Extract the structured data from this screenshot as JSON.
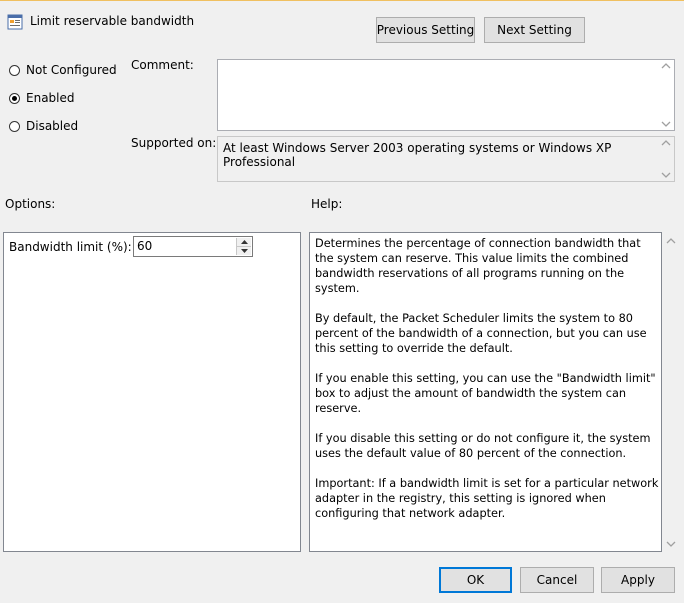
{
  "window": {
    "title": "Limit reservable bandwidth",
    "icon": "policy-setting-icon"
  },
  "nav": {
    "previous_label": "Previous Setting",
    "next_label": "Next Setting"
  },
  "state": {
    "options": [
      "Not Configured",
      "Enabled",
      "Disabled"
    ],
    "selected": "Enabled"
  },
  "comment": {
    "label": "Comment:",
    "value": ""
  },
  "supported": {
    "label": "Supported on:",
    "value": "At least Windows Server 2003 operating systems or Windows XP Professional"
  },
  "options_section": {
    "header": "Options:",
    "bandwidth_label": "Bandwidth limit (%):",
    "bandwidth_value": "60"
  },
  "help": {
    "header": "Help:",
    "paragraphs": [
      "Determines the percentage of connection bandwidth that the system can reserve. This value limits the combined bandwidth reservations of all programs running on the system.",
      "By default, the Packet Scheduler limits the system to 80 percent of the bandwidth of a connection, but you can use this setting to override the default.",
      "If you enable this setting, you can use the \"Bandwidth limit\" box to adjust the amount of bandwidth the system can reserve.",
      "If you disable this setting or do not configure it, the system uses the default value of 80 percent of the connection.",
      "Important: If a bandwidth limit is set for a particular network adapter in the registry, this setting is ignored when configuring that network adapter."
    ]
  },
  "footer": {
    "ok_label": "OK",
    "cancel_label": "Cancel",
    "apply_label": "Apply"
  }
}
